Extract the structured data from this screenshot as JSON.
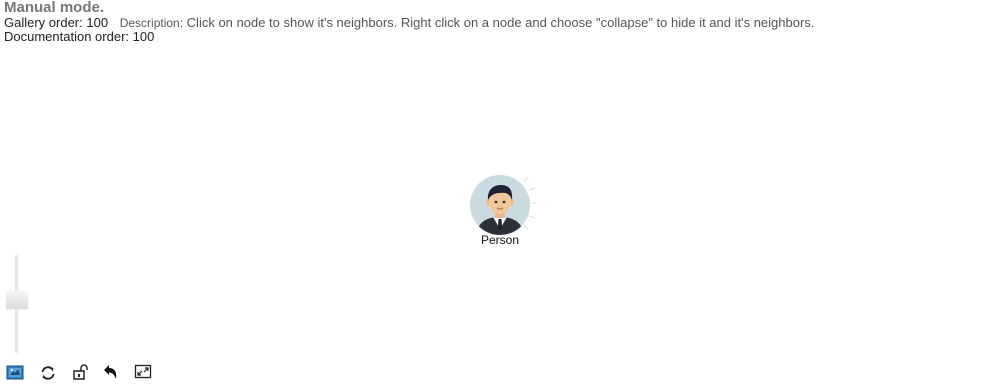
{
  "header": {
    "title": "Manual mode.",
    "gallery_order_label": "Gallery order: 100",
    "description_label": "Description:",
    "description_text": "Click on node to show it's neighbors. Right click on a node and choose \"collapse\" to hide it and it's neighbors.",
    "documentation_order_label": "Documentation order: 100"
  },
  "graph": {
    "node": {
      "label": "Person",
      "icon": "person-avatar-icon"
    }
  },
  "controls": {
    "zoom_level": 0.7,
    "toolbar": [
      {
        "icon": "navigator-icon"
      },
      {
        "icon": "refresh-layout-icon"
      },
      {
        "icon": "unlock-icon"
      },
      {
        "icon": "undo-icon"
      },
      {
        "icon": "fullscreen-icon"
      }
    ]
  },
  "colors": {
    "title": "#777777",
    "node_circle": "#c9dbe1",
    "navigator_accent": "#2f7fc1"
  }
}
